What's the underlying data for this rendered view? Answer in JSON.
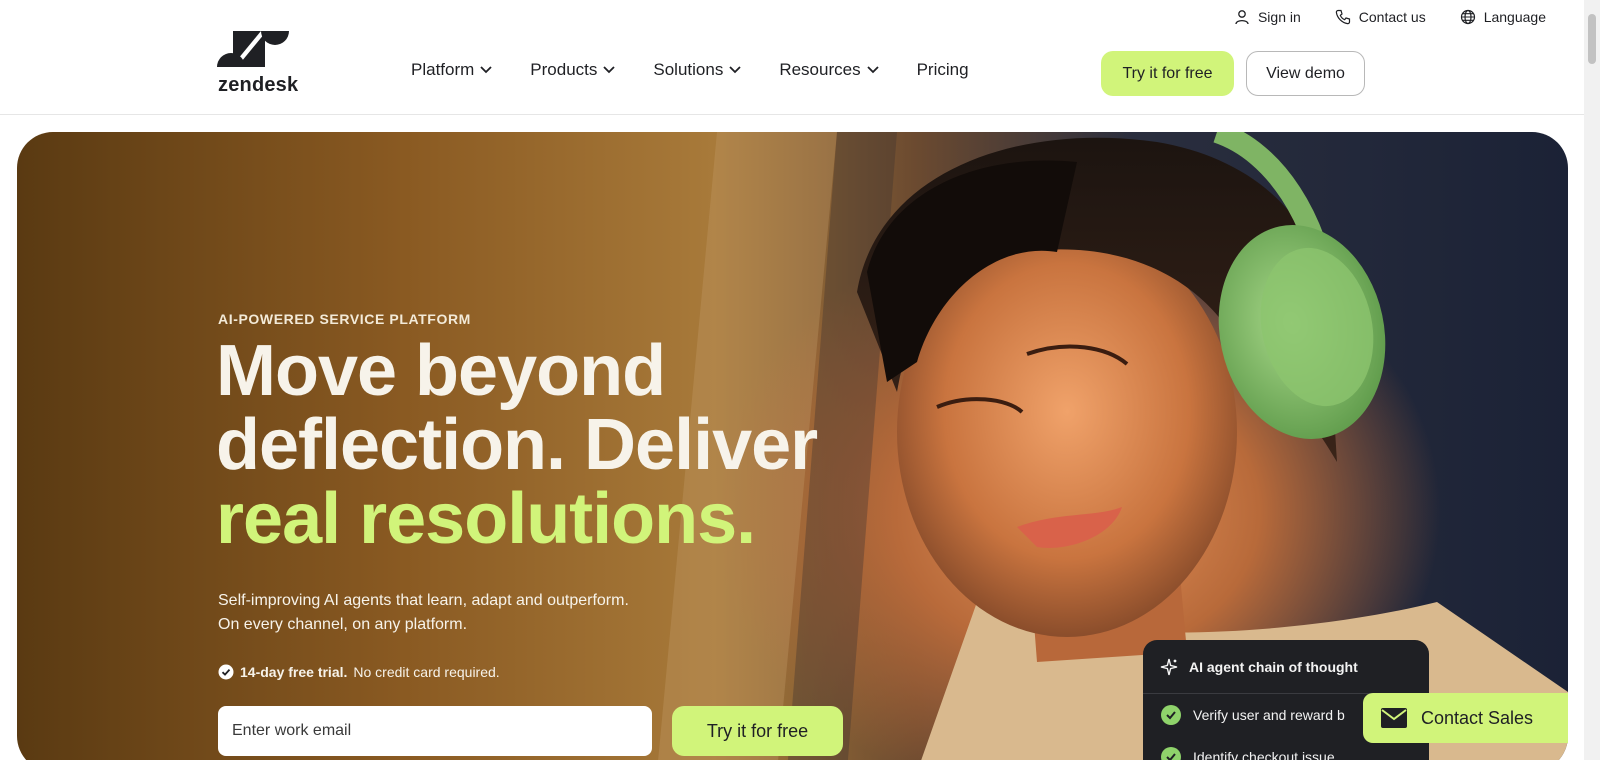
{
  "utility": {
    "sign_in": "Sign in",
    "contact_us": "Contact us",
    "language": "Language"
  },
  "brand": {
    "name": "zendesk"
  },
  "nav": {
    "items": [
      {
        "label": "Platform",
        "has_dropdown": true
      },
      {
        "label": "Products",
        "has_dropdown": true
      },
      {
        "label": "Solutions",
        "has_dropdown": true
      },
      {
        "label": "Resources",
        "has_dropdown": true
      },
      {
        "label": "Pricing",
        "has_dropdown": false
      }
    ],
    "try_free": "Try it for free",
    "view_demo": "View demo"
  },
  "hero": {
    "eyebrow": "AI-POWERED SERVICE PLATFORM",
    "headline_line1": "Move beyond",
    "headline_line2": "deflection. Deliver",
    "headline_accent": "real resolutions.",
    "sub_line1": "Self-improving AI agents that learn, adapt and outperform.",
    "sub_line2": "On every channel, on any platform.",
    "trial_bold": "14-day free trial.",
    "trial_rest": "No credit card required.",
    "email_placeholder": "Enter work email",
    "try_free": "Try it for free"
  },
  "ai_card": {
    "title": "AI agent chain of thought",
    "steps": [
      "Verify user and reward b",
      "Identify checkout issue"
    ]
  },
  "contact_sales": "Contact Sales",
  "colors": {
    "accent": "#d1f47a",
    "text": "#1f2024",
    "card_bg": "#1f2024"
  },
  "icons": [
    "person-icon",
    "phone-icon",
    "globe-icon",
    "chevron-down-icon",
    "check-circle-icon",
    "sparkle-icon",
    "mail-icon"
  ]
}
